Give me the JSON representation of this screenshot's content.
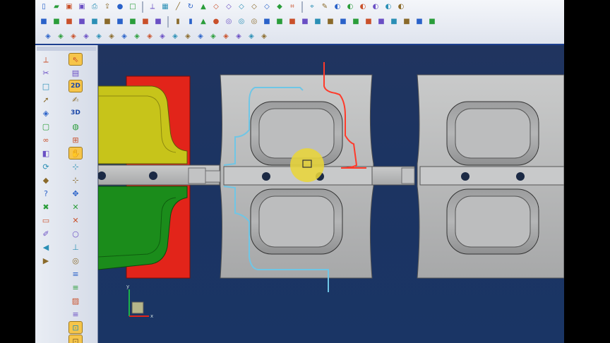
{
  "theme": {
    "accent": "#1d3f8f",
    "viewport_bg": "#1d3462",
    "mold_gray": "#b9babb",
    "yellow_part": "#c7c41a",
    "green_part": "#1b8c1b",
    "red_part": "#e2241a",
    "cavity_red_curve": "#ff3a2a",
    "cavity_cyan_curve": "#6fc6e6",
    "highlight": "#e8d53a"
  },
  "toolbar": {
    "row1": [
      "new-file-icon",
      "open-folder-icon",
      "save-as-icon",
      "save-icon",
      "print-icon",
      "export-icon",
      "sphere-icon",
      "frame-icon",
      "|",
      "measure-icon",
      "grid-move-icon",
      "line-icon",
      "cycle-icon",
      "cone-icon",
      "cube-wire-icon",
      "cube-wire-icon",
      "cube-wire-icon",
      "cube-wire-icon",
      "cube-wire-icon",
      "cube-solid-icon",
      "fit-icon",
      "|",
      "pin-icon",
      "pen-icon",
      "shade-icon",
      "shade-icon",
      "shade-icon",
      "shade-icon",
      "shade-icon",
      "shade-icon"
    ],
    "row2": [
      "solid-box-icon",
      "solid-box-icon",
      "solid-box-icon",
      "solid-box-icon",
      "solid-box-icon",
      "solid-box-icon",
      "solid-box-icon",
      "solid-box-icon",
      "solid-box-icon",
      "solid-box-icon",
      "|",
      "cylinder-icon",
      "cylinder-icon",
      "cone-icon",
      "sphere-icon",
      "torus-icon",
      "torus-icon",
      "torus-icon",
      "solid-box-icon",
      "solid-box-icon",
      "solid-box-icon",
      "solid-box-icon",
      "solid-box-icon",
      "solid-box-icon",
      "solid-box-icon",
      "solid-box-icon",
      "solid-box-icon",
      "solid-box-icon",
      "solid-box-icon",
      "solid-box-icon",
      "solid-box-icon",
      "solid-box-icon"
    ],
    "row3": [
      "surface-icon",
      "surface-icon",
      "surface-icon",
      "surface-icon",
      "surface-icon",
      "surface-icon",
      "surface-icon",
      "surface-icon",
      "surface-icon",
      "surface-icon",
      "surface-icon",
      "surface-icon",
      "surface-icon",
      "surface-icon",
      "surface-icon",
      "surface-icon",
      "surface-icon",
      "surface-icon"
    ]
  },
  "side_panel": {
    "left_column": [
      "measure-icon",
      "cut-icon",
      "frame-icon",
      "arrow-icon",
      "surface-icon",
      "box-icon",
      "link-icon",
      "view-icon",
      "rotate-icon",
      "cube-icon",
      "question-icon",
      "delete-icon",
      "flat-icon",
      "pencil-icon",
      "arrow-left-icon",
      "arrow-right-icon"
    ],
    "right_column": [
      "pick-icon",
      "page-icon",
      "mode-2d",
      "sketch-icon",
      "mode-3d",
      "globe-icon",
      "grid-icon",
      "hand-icon",
      "node-icon",
      "node-icon",
      "move-icon",
      "cross-icon",
      "cross-icon",
      "circle-icon",
      "split-icon",
      "target-icon",
      "align-icon",
      "align-icon",
      "hatch-icon",
      "align-icon",
      "snap-icon",
      "snap-icon",
      "axis-icon"
    ],
    "mode_2d": "2D",
    "mode_3d": "3D"
  },
  "axis_triad": {
    "x_label": "x",
    "y_label": "y"
  },
  "cursor_marker": "highlight-circle"
}
